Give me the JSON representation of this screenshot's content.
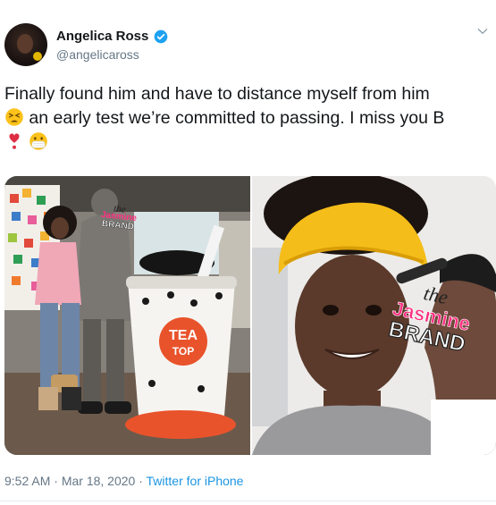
{
  "user": {
    "name": "Angelica Ross",
    "handle": "@angelicaross",
    "verified": true,
    "avatar_icon": "profile-photo"
  },
  "tweet": {
    "text_line1": "Finally found him and have to distance myself from him",
    "text_line2": " an early test we’re committed to passing.  I miss you B",
    "emoji_1": "tired-face-emoji",
    "emoji_2": "red-exclamation-heart-emoji",
    "emoji_3": "mask-face-emoji"
  },
  "images": {
    "left": {
      "watermark_top": "the",
      "watermark_mid": "Jasmine",
      "watermark_bottom": "BRAND",
      "cup_logo_top": "TEA",
      "cup_logo_bottom": "TOP"
    },
    "right": {
      "watermark_top": "the",
      "watermark_mid": "Jasmine",
      "watermark_bottom": "BRAND"
    }
  },
  "footer": {
    "time": "9:52 AM",
    "sep1": " · ",
    "date": "Mar 18, 2020",
    "sep2": " · ",
    "source": "Twitter for iPhone"
  },
  "colors": {
    "link": "#1b95e0",
    "secondary_text": "#657786",
    "verified_badge": "#1da1f2"
  }
}
